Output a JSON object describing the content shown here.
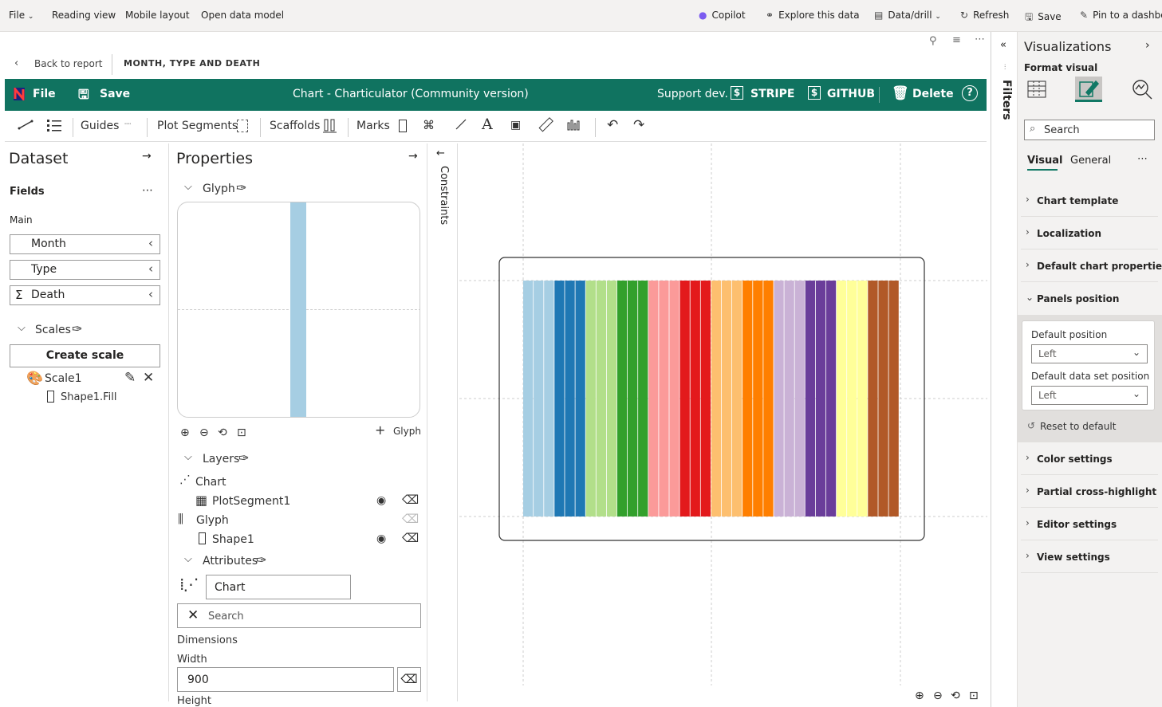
{
  "topbar": {
    "file": "File",
    "reading_view": "Reading view",
    "mobile_layout": "Mobile layout",
    "open_data_model": "Open data model",
    "copilot": "Copilot",
    "explore": "Explore this data",
    "data_drill": "Data/drill",
    "refresh": "Refresh",
    "save": "Save",
    "pin": "Pin to a dashbo"
  },
  "report": {
    "back": "Back to report",
    "page_title": "MONTH, TYPE AND DEATH"
  },
  "charticulator": {
    "file": "File",
    "save": "Save",
    "title": "Chart - Charticulator (Community version)",
    "support": "Support dev.",
    "stripe": "STRIPE",
    "github": "GITHUB",
    "delete": "Delete"
  },
  "toolbar": {
    "guides": "Guides",
    "plot_segments": "Plot Segments",
    "scaffolds": "Scaffolds",
    "marks": "Marks"
  },
  "dataset": {
    "title": "Dataset",
    "fields": "Fields",
    "main": "Main",
    "columns": [
      "Month",
      "Type",
      "Death"
    ],
    "scales_label": "Scales",
    "create_scale": "Create scale",
    "scale_name": "Scale1",
    "scale_mapping": "Shape1.Fill"
  },
  "properties": {
    "title": "Properties",
    "glyph": "Glyph",
    "add_glyph": "Glyph",
    "layers": "Layers",
    "layer_items": [
      "Chart",
      "PlotSegment1",
      "Glyph",
      "Shape1"
    ],
    "attributes": "Attributes",
    "attr_name": "Chart",
    "search_placeholder": "Search",
    "dimensions": "Dimensions",
    "width_label": "Width",
    "width_value": "900",
    "height_label": "Height"
  },
  "constraints": {
    "label": "Constraints"
  },
  "canvas": {
    "bar_colors": [
      "#a6cee3",
      "#a6cee3",
      "#a6cee3",
      "#1f78b4",
      "#1f78b4",
      "#1f78b4",
      "#b2df8a",
      "#b2df8a",
      "#b2df8a",
      "#33a02c",
      "#33a02c",
      "#33a02c",
      "#fb9a99",
      "#fb9a99",
      "#fb9a99",
      "#e31a1c",
      "#e31a1c",
      "#e31a1c",
      "#fdbf6f",
      "#fdbf6f",
      "#fdbf6f",
      "#ff7f00",
      "#ff7f00",
      "#ff7f00",
      "#cab2d6",
      "#cab2d6",
      "#cab2d6",
      "#6a3d9a",
      "#6a3d9a",
      "#6a3d9a",
      "#ffff99",
      "#ffff99",
      "#ffff99",
      "#b15928",
      "#b15928",
      "#b15928"
    ]
  },
  "filters": {
    "label": "Filters"
  },
  "viz": {
    "title": "Visualizations",
    "format_visual": "Format visual",
    "search_placeholder": "Search",
    "tab_visual": "Visual",
    "tab_general": "General",
    "sections": [
      "Chart template",
      "Localization",
      "Default chart properties",
      "Panels position",
      "Color settings",
      "Partial cross-highlight",
      "Editor settings",
      "View settings"
    ],
    "default_position_label": "Default position",
    "default_position_value": "Left",
    "default_dataset_position_label": "Default data set position",
    "default_dataset_position_value": "Left",
    "reset": "Reset to default"
  },
  "colors": {
    "header_green": "#107360",
    "accent": "#117865"
  }
}
